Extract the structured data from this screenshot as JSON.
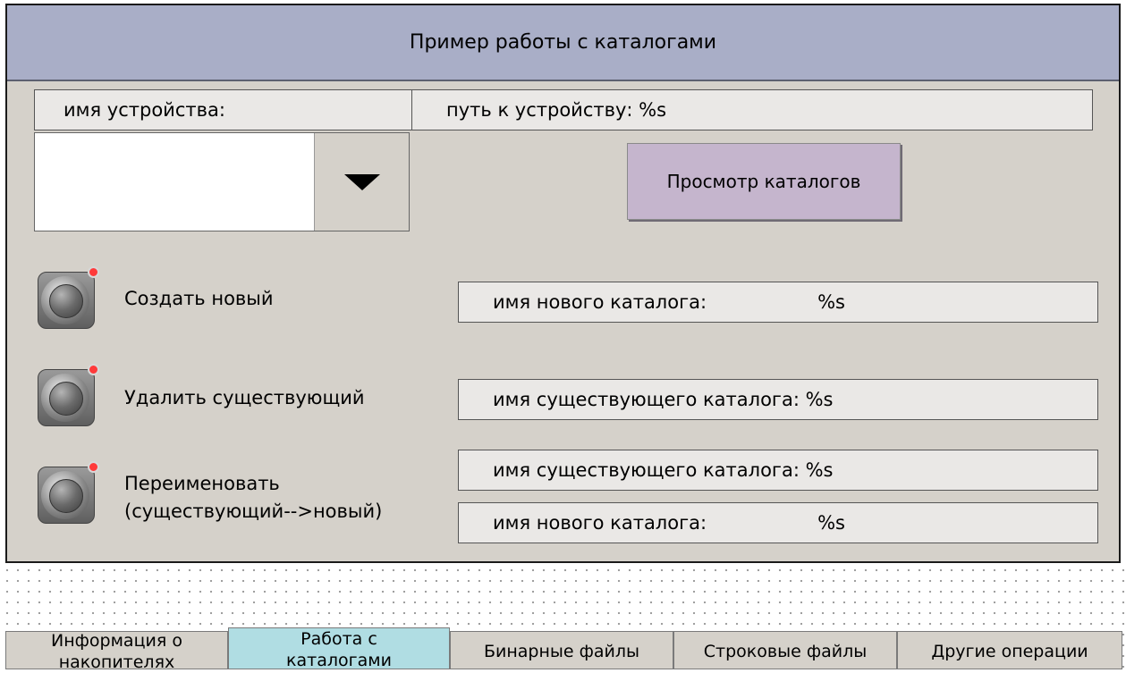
{
  "window": {
    "title": "Пример работы с каталогами"
  },
  "device": {
    "name_label": "имя устройства:",
    "path_label": "путь к устройству: %s",
    "selected_value": ""
  },
  "buttons": {
    "view_catalogs": "Просмотр каталогов"
  },
  "actions": {
    "create": {
      "label": "Создать новый",
      "field": "имя нового каталога:",
      "value": "%s"
    },
    "delete": {
      "label": "Удалить существующий",
      "field": "имя существующего каталога: %s"
    },
    "rename": {
      "label_line1": "Переименовать",
      "label_line2": "(существующий-->новый)",
      "field_existing": "имя существующего каталога: %s",
      "field_new": "имя нового каталога:",
      "field_new_value": "%s"
    }
  },
  "tabs": [
    {
      "line1": "Информация о",
      "line2": "накопителях"
    },
    {
      "line1": "Работа с",
      "line2": "каталогами"
    },
    {
      "line1": "Бинарные файлы",
      "line2": ""
    },
    {
      "line1": "Строковые файлы",
      "line2": ""
    },
    {
      "line1": "Другие операции",
      "line2": ""
    }
  ],
  "colors": {
    "panel": "#d5d1ca",
    "title_bar": "#a9aec7",
    "view_button": "#c5b5cd",
    "active_tab": "#b0dde3",
    "led": "#ff3a3a"
  }
}
